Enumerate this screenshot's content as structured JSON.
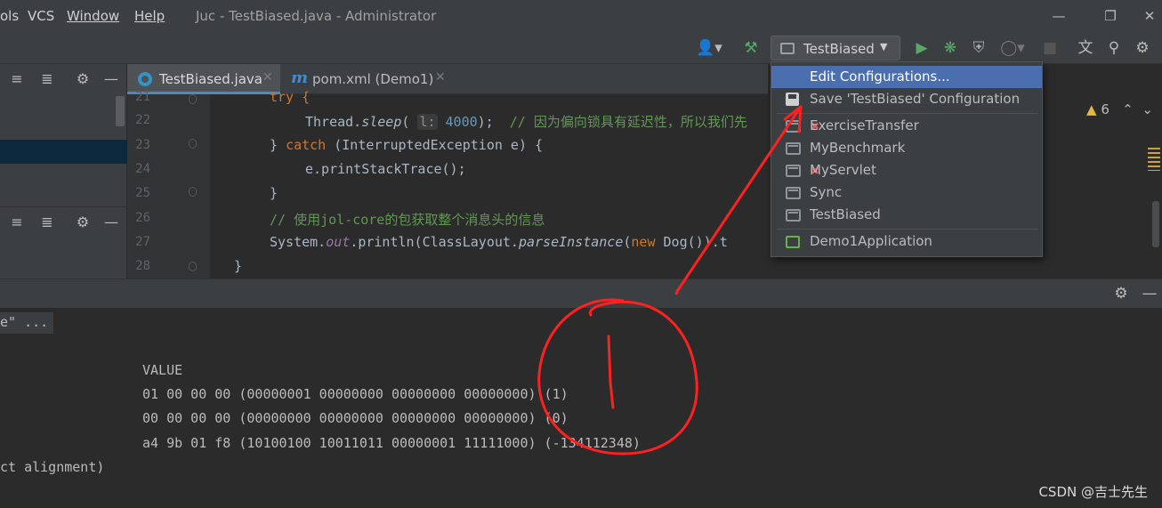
{
  "menu": {
    "items": [
      "ols",
      "VCS",
      "Window",
      "Help"
    ]
  },
  "window": {
    "title": "Juc - TestBiased.java - Administrator"
  },
  "toolbar": {
    "run_config": "TestBiased"
  },
  "tabs": [
    {
      "label": "TestBiased.java"
    },
    {
      "label": "pom.xml (Demo1)"
    }
  ],
  "editor": {
    "line_numbers": [
      "21",
      "22",
      "23",
      "24",
      "25",
      "26",
      "27",
      "28"
    ],
    "warning_count": "6",
    "lines": {
      "l21": "try {",
      "l22_pre": "Thread.",
      "l22_method": "sleep",
      "l22_open": "( ",
      "l22_hint": "l:",
      "l22_num": " 4000",
      "l22_close": ");  ",
      "l22_comment": "// 因为偏向锁具有延迟性，所以我们先",
      "l23_close": "} ",
      "l23_catch": "catch",
      "l23_rest": " (InterruptedException e) {",
      "l24": "e.printStackTrace();",
      "l25": "}",
      "l26_comment": "// 使用jol-core的包获取整个消息头的信息",
      "l27_pre": "System.",
      "l27_out": "out",
      "l27_mid": ".println(ClassLayout.",
      "l27_parse": "parseInstance",
      "l27_open": "(",
      "l27_new": "new",
      "l27_rest": " Dog()).t",
      "l28": "}"
    }
  },
  "console": {
    "folded": "e\" ...",
    "header": "VALUE",
    "rows": [
      "01 00 00 00 (00000001 00000000 00000000 00000000) (1)",
      "00 00 00 00 (00000000 00000000 00000000 00000000) (0)",
      "a4 9b 01 f8 (10100100 10011011 00000001 11111000) (-134112348)"
    ],
    "footer": "ct alignment)"
  },
  "dropdown": {
    "edit": "Edit Configurations...",
    "save": "Save 'TestBiased' Configuration",
    "configs": [
      "ExerciseTransfer",
      "MyBenchmark",
      "MyServlet",
      "Sync",
      "TestBiased"
    ],
    "spring_app": "Demo1Application"
  },
  "watermark": "CSDN @吉士先生",
  "colors": {
    "accent": "#4b6eaf",
    "annotation": "#ff2020",
    "run": "#59a869"
  }
}
